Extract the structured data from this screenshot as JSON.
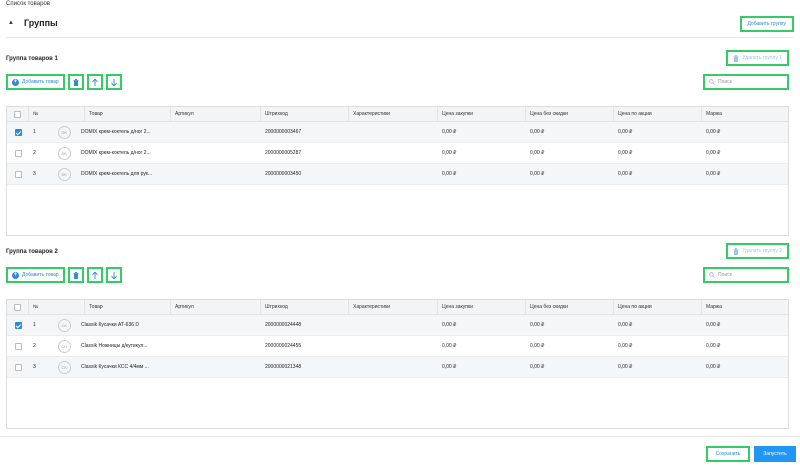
{
  "page": {
    "label": "Список товаров",
    "section_title": "Группы",
    "add_group": "Добавить группу"
  },
  "columns": [
    "№",
    "Товар",
    "Артикул",
    "Штрихкод",
    "Характеристики",
    "Цена закупки",
    "Цена без скидки",
    "Цена по акции",
    "Маржа"
  ],
  "groups": [
    {
      "title": "Группа товаров 1",
      "delete_label": "Удалить группу 1",
      "add_item": "Добавить товар",
      "search_placeholder": "Поиск",
      "rows": [
        {
          "checked": true,
          "num": "1",
          "avatar": "DK",
          "name": "DOMIX крем-коктель д/ног 2...",
          "article": "",
          "barcode": "2000000003467",
          "props": "",
          "purchase": "0,00 ₽",
          "price": "0,00 ₽",
          "promo": "0,00 ₽",
          "margin": "0,00 ₽"
        },
        {
          "checked": false,
          "num": "2",
          "avatar": "DK",
          "name": "DOMIX крем-коктель д/ног 2...",
          "article": "",
          "barcode": "2000000005287",
          "props": "",
          "purchase": "0,00 ₽",
          "price": "0,00 ₽",
          "promo": "0,00 ₽",
          "margin": "0,00 ₽"
        },
        {
          "checked": false,
          "num": "3",
          "avatar": "DK",
          "name": "DOMIX крем-коктель для рук...",
          "article": "",
          "barcode": "2000000003450",
          "props": "",
          "purchase": "0,00 ₽",
          "price": "0,00 ₽",
          "promo": "0,00 ₽",
          "margin": "0,00 ₽"
        }
      ]
    },
    {
      "title": "Группа товаров 2",
      "delete_label": "Удалить группу 2",
      "add_item": "Добавить товар",
      "search_placeholder": "Поиск",
      "rows": [
        {
          "checked": true,
          "num": "1",
          "avatar": "CK",
          "name": "Classik Кусачки АТ-636 D",
          "article": "",
          "barcode": "2000000024448",
          "props": "",
          "purchase": "0,00 ₽",
          "price": "0,00 ₽",
          "promo": "0,00 ₽",
          "margin": "0,00 ₽"
        },
        {
          "checked": false,
          "num": "2",
          "avatar": "CH",
          "name": "Classik Ножницы д/кутикул...",
          "article": "",
          "barcode": "2000000024455",
          "props": "",
          "purchase": "0,00 ₽",
          "price": "0,00 ₽",
          "promo": "0,00 ₽",
          "margin": "0,00 ₽"
        },
        {
          "checked": false,
          "num": "3",
          "avatar": "CK",
          "name": "Classik Кусачки КСС 4/4мм ...",
          "article": "",
          "barcode": "2000000021348",
          "props": "",
          "purchase": "0,00 ₽",
          "price": "0,00 ₽",
          "promo": "0,00 ₽",
          "margin": "0,00 ₽"
        }
      ]
    }
  ],
  "footer": {
    "save": "Сохранить",
    "run": "Запустить"
  },
  "colors": {
    "accent": "#2196f3",
    "highlight": "#33cc66"
  }
}
